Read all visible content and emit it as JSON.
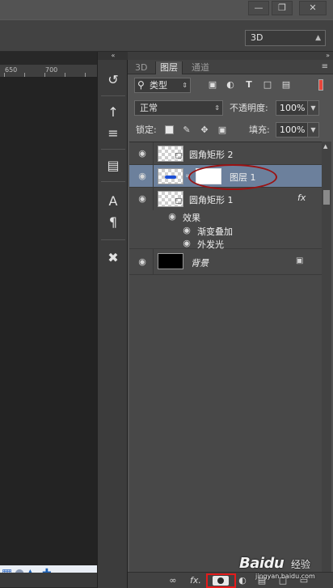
{
  "window": {
    "minimize_icon": "minimize-icon",
    "restore_icon": "restore-icon",
    "close_icon": "close-icon"
  },
  "options_bar": {
    "mode": "3D"
  },
  "ruler": {
    "ticks": [
      "650",
      "700"
    ]
  },
  "tools": [
    "history-brush-icon",
    "clone-stamp-icon",
    "brush-presets-icon",
    "layer-comps-icon",
    "character-icon",
    "paragraph-icon",
    "tool-presets-icon"
  ],
  "layers_panel": {
    "tabs": [
      {
        "label": "3D",
        "active": false
      },
      {
        "label": "图层",
        "active": true
      },
      {
        "label": "通道",
        "active": false
      }
    ],
    "filter": {
      "label": "类型"
    },
    "blend_mode": "正常",
    "opacity_label": "不透明度:",
    "opacity_value": "100%",
    "lock_label": "锁定:",
    "fill_label": "填充:",
    "fill_value": "100%",
    "layers": [
      {
        "name": "圆角矩形 2",
        "visible": true,
        "selected": false
      },
      {
        "name": "图层 1",
        "visible": true,
        "selected": true
      },
      {
        "name": "圆角矩形 1",
        "visible": true,
        "selected": false,
        "fx": "fx",
        "effects_label": "效果",
        "effects": [
          "渐变叠加",
          "外发光"
        ]
      },
      {
        "name": "背景",
        "visible": true,
        "selected": false,
        "locked": true
      }
    ],
    "footer_buttons": [
      "link-layers-icon",
      "fx-icon",
      "add-mask-icon",
      "adjustment-layer-icon",
      "new-group-icon",
      "new-layer-icon",
      "delete-layer-icon"
    ]
  },
  "annotations": {
    "highlight_color": "#e41b1b",
    "oval_color": "#9a1212"
  },
  "watermark": {
    "main": "Baidu",
    "cn": "经验",
    "sub": "jingyan.baidu.com"
  }
}
